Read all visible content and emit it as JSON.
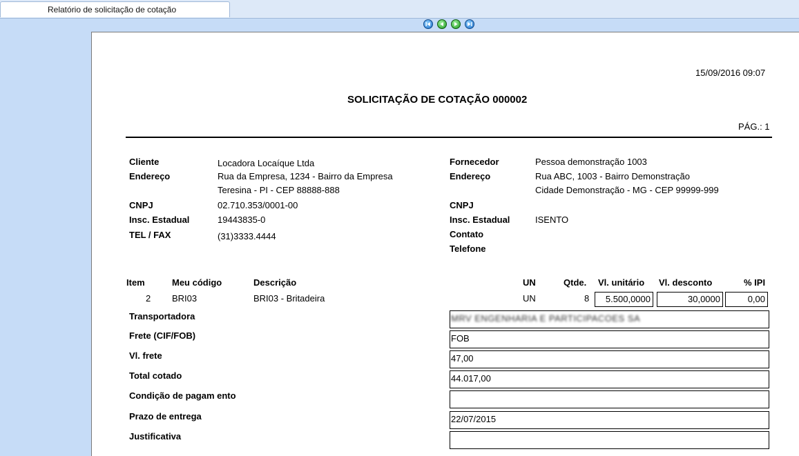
{
  "window": {
    "tab_title": "Relatório de solicitação de cotação"
  },
  "nav": {
    "first_icon": "first-page-icon",
    "prev_icon": "previous-page-icon",
    "next_icon": "next-page-icon",
    "last_icon": "last-page-icon"
  },
  "report": {
    "datetime": "15/09/2016 09:07",
    "title": "SOLICITAÇÃO DE COTAÇÃO 000002",
    "page": "PÁG.: 1",
    "client": {
      "label_cliente": "Cliente",
      "label_endereco": "Endereço",
      "label_cnpj": "CNPJ",
      "label_insc": "Insc. Estadual",
      "label_tel": "TEL / FAX",
      "name": "Locadora Locaíque Ltda",
      "address1": "Rua da Empresa, 1234 - Bairro da Empresa",
      "address2": "Teresina - PI -  CEP 88888-888",
      "cnpj": "02.710.353/0001-00",
      "insc": "19443835-0",
      "tel": "(31)3333.4444"
    },
    "supplier": {
      "label_fornecedor": "Fornecedor",
      "label_endereco": "Endereço",
      "label_cnpj": "CNPJ",
      "label_insc": "Insc. Estadual",
      "label_contato": "Contato",
      "label_telefone": "Telefone",
      "name": "Pessoa demonstração 1003",
      "address1": "Rua ABC, 1003 - Bairro Demonstração",
      "address2": "Cidade Demonstração - MG -  CEP 99999-999",
      "insc": "ISENTO"
    },
    "items_header": {
      "item": "Item",
      "code": "Meu código",
      "desc": "Descrição",
      "un": "UN",
      "qty": "Qtde.",
      "unit_price": "Vl. unitário",
      "discount": "Vl. desconto",
      "ipi": "% IPI"
    },
    "items": [
      {
        "item": "2",
        "code": "BRI03",
        "desc": "BRI03 - Britadeira",
        "un": "UN",
        "qty": "8",
        "unit_price": "5.500,0000",
        "discount": "30,0000",
        "ipi": "0,00"
      }
    ],
    "footer": {
      "transportadora_label": "Transportadora",
      "transportadora_value": "MRV ENGENHARIA E PARTICIPACOES SA",
      "frete_label": "Frete (CIF/FOB)",
      "frete_value": "FOB",
      "vl_frete_label": "Vl. frete",
      "vl_frete_value": "47,00",
      "total_label": "Total cotado",
      "total_value": "44.017,00",
      "cond_label": "Condição de pagam ento",
      "cond_value": "",
      "prazo_label": "Prazo de entrega",
      "prazo_value": "22/07/2015",
      "just_label": "Justificativa",
      "just_value": ""
    }
  }
}
